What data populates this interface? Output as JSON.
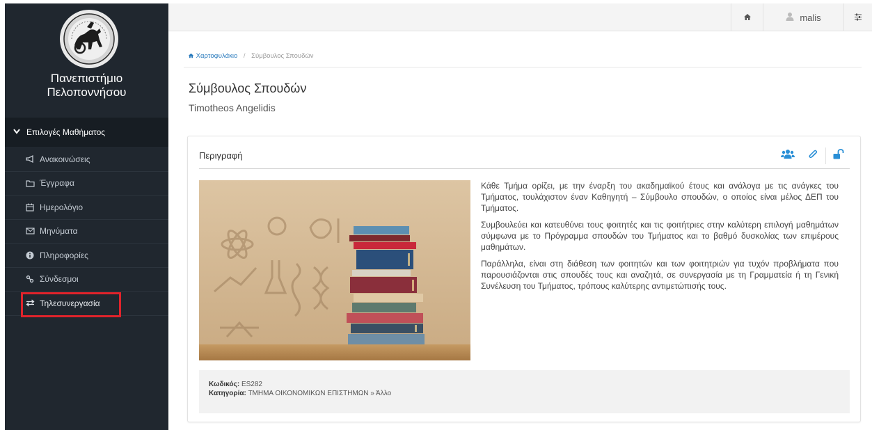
{
  "sidebar": {
    "university_line1": "Πανεπιστήμιο",
    "university_line2": "Πελοποννήσου",
    "menu_header": "Επιλογές Μαθήματος",
    "items": [
      {
        "label": "Ανακοινώσεις",
        "icon": "megaphone-icon"
      },
      {
        "label": "Έγγραφα",
        "icon": "folder-icon"
      },
      {
        "label": "Ημερολόγιο",
        "icon": "calendar-icon"
      },
      {
        "label": "Μηνύματα",
        "icon": "envelope-icon"
      },
      {
        "label": "Πληροφορίες",
        "icon": "info-icon"
      },
      {
        "label": "Σύνδεσμοι",
        "icon": "link-icon"
      },
      {
        "label": "Τηλεσυνεργασία",
        "icon": "exchange-icon"
      }
    ],
    "highlight_color": "#e0232b"
  },
  "topbar": {
    "username": "malis"
  },
  "breadcrumb": {
    "home": "Χαρτοφυλάκιο",
    "current": "Σύμβουλος Σπουδών"
  },
  "page": {
    "title": "Σύμβουλος Σπουδών",
    "subtitle": "Timotheos Angelidis"
  },
  "panel": {
    "title": "Περιγραφή",
    "paragraphs": [
      "Κάθε Τμήμα ορίζει, με την έναρξη του ακαδημαϊκού έτους και ανάλογα με τις ανάγκες του Τμήματος, τουλάχιστον έναν Καθηγητή – Σύμβουλο σπουδών, ο οποίος είναι μέλος ΔΕΠ του Τμήματος.",
      "Συμβουλεύει και κατευθύνει τους φοιτητές και τις φοιτήτριες στην καλύτερη επιλογή μαθημάτων σύμφωνα με το Πρόγραμμα σπουδών του Τμήματος και το βαθμό δυσκολίας των επιμέρους μαθημάτων.",
      "Παράλληλα, είναι στη διάθεση των φοιτητών και των φοιτητριών για τυχόν προβλήματα που παρουσιάζονται στις σπουδές τους και αναζητά, σε συνεργασία με τη Γραμματεία ή τη Γενική Συνέλευση του Τμήματος, τρόπους καλύτερης αντιμετώπισής τους."
    ],
    "code_label": "Κωδικός:",
    "code_value": "ES282",
    "category_label": "Κατηγορία:",
    "category_value": "ΤΜΗΜΑ ΟΙΚΟΝΟΜΙΚΩΝ ΕΠΙΣΤΗΜΩΝ » Άλλο",
    "accent_color": "#2a8fd6"
  }
}
